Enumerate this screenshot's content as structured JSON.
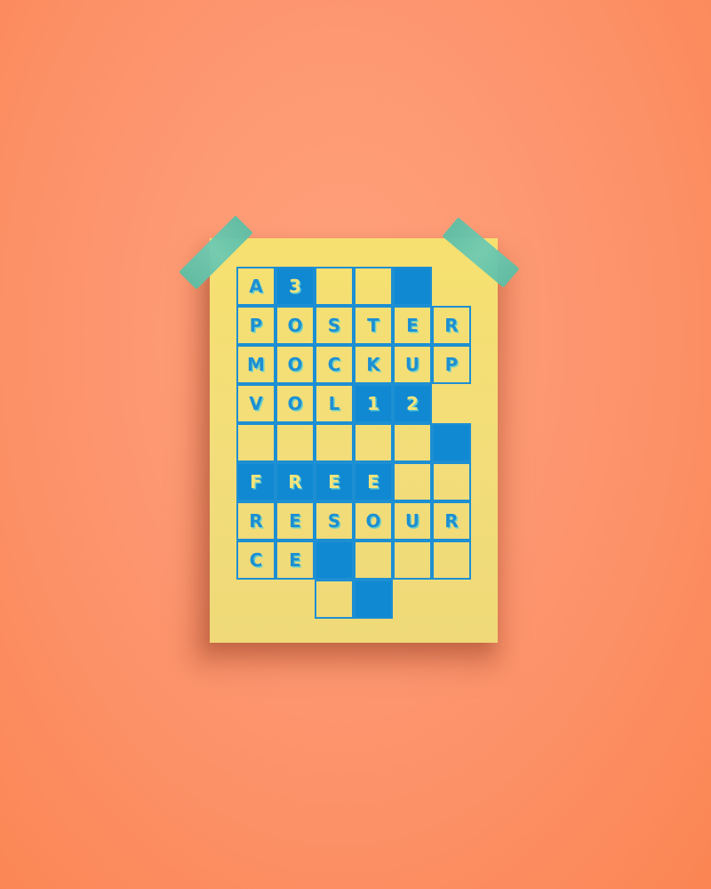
{
  "scene": {
    "background_color": "#fd9670",
    "poster_color": "#f2dd7a",
    "ink_color": "#1d8fd2",
    "tape_color": "#5fc4a8"
  },
  "poster": {
    "rows": [
      [
        {
          "t": "A"
        },
        {
          "t": "3",
          "f": true
        },
        {
          "t": ""
        },
        {
          "t": ""
        },
        {
          "t": "",
          "f": true
        }
      ],
      [
        {
          "t": "P"
        },
        {
          "t": "O"
        },
        {
          "t": "S"
        },
        {
          "t": "T"
        },
        {
          "t": "E"
        },
        {
          "t": "R"
        }
      ],
      [
        {
          "t": "M"
        },
        {
          "t": "O"
        },
        {
          "t": "C"
        },
        {
          "t": "K"
        },
        {
          "t": "U"
        },
        {
          "t": "P"
        }
      ],
      [
        {
          "t": "V"
        },
        {
          "t": "O"
        },
        {
          "t": "L"
        },
        {
          "t": "1",
          "f": true
        },
        {
          "t": "2",
          "f": true
        }
      ],
      [
        {
          "t": ""
        },
        {
          "t": ""
        },
        {
          "t": ""
        },
        {
          "t": ""
        },
        {
          "t": ""
        },
        {
          "t": "",
          "f": true
        }
      ],
      [
        {
          "t": "F",
          "f": true
        },
        {
          "t": "R",
          "f": true
        },
        {
          "t": "E",
          "f": true
        },
        {
          "t": "E",
          "f": true
        },
        {
          "t": ""
        },
        {
          "t": ""
        }
      ],
      [
        {
          "t": "R"
        },
        {
          "t": "E"
        },
        {
          "t": "S"
        },
        {
          "t": "O"
        },
        {
          "t": "U"
        },
        {
          "t": "R"
        }
      ],
      [
        {
          "t": "C"
        },
        {
          "t": "E"
        },
        {
          "t": "",
          "f": true
        },
        {
          "t": ""
        },
        {
          "t": ""
        },
        {
          "t": ""
        }
      ],
      [
        null,
        null,
        {
          "t": ""
        },
        {
          "t": "",
          "f": true
        }
      ]
    ]
  }
}
